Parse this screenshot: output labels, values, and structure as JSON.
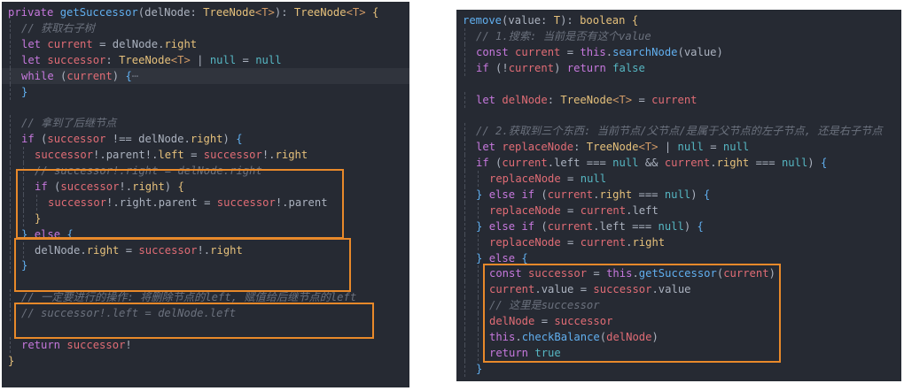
{
  "colors": {
    "background": "#262a33",
    "highlight_box": "#e8892a",
    "keyword": "#c678dd",
    "function": "#61afef",
    "type": "#e5c07b",
    "variable": "#e06c75",
    "comment": "#6b717d"
  },
  "left_code": {
    "lines": [
      {
        "indent": 0,
        "hl": false,
        "tokens": [
          [
            "kw",
            "private"
          ],
          [
            "tx",
            " "
          ],
          [
            "fn",
            "getSuccessor"
          ],
          [
            "tx",
            "(delNode: "
          ],
          [
            "ty",
            "TreeNode"
          ],
          [
            "gn",
            "<T>"
          ],
          [
            "tx",
            "): "
          ],
          [
            "ty",
            "TreeNode"
          ],
          [
            "gn",
            "<T>"
          ],
          [
            "tx",
            " "
          ],
          [
            "br",
            "{"
          ]
        ]
      },
      {
        "indent": 1,
        "hl": false,
        "tokens": [
          [
            "cm",
            "// 获取右子树"
          ]
        ]
      },
      {
        "indent": 1,
        "hl": false,
        "tokens": [
          [
            "kw",
            "let"
          ],
          [
            "tx",
            " "
          ],
          [
            "var",
            "current"
          ],
          [
            "tx",
            " = delNode."
          ],
          [
            "pr",
            "right"
          ]
        ]
      },
      {
        "indent": 1,
        "hl": false,
        "tokens": [
          [
            "kw",
            "let"
          ],
          [
            "tx",
            " "
          ],
          [
            "var",
            "successor"
          ],
          [
            "tx",
            ": "
          ],
          [
            "ty",
            "TreeNode"
          ],
          [
            "gn",
            "<T>"
          ],
          [
            "tx",
            " | "
          ],
          [
            "nl",
            "null"
          ],
          [
            "tx",
            " = "
          ],
          [
            "nl",
            "null"
          ]
        ]
      },
      {
        "indent": 1,
        "hl": true,
        "tokens": [
          [
            "kw",
            "while"
          ],
          [
            "tx",
            " ("
          ],
          [
            "var",
            "current"
          ],
          [
            "tx",
            ") "
          ],
          [
            "bl",
            "{"
          ],
          [
            "el",
            "⋯"
          ]
        ]
      },
      {
        "indent": 1,
        "hl": false,
        "tokens": [
          [
            "bl",
            "}"
          ]
        ]
      },
      {
        "indent": 0,
        "hl": false,
        "tokens": []
      },
      {
        "indent": 1,
        "hl": false,
        "tokens": [
          [
            "cm",
            "// 拿到了后继节点"
          ]
        ]
      },
      {
        "indent": 1,
        "hl": false,
        "tokens": [
          [
            "kw",
            "if"
          ],
          [
            "tx",
            " ("
          ],
          [
            "var",
            "successor"
          ],
          [
            "tx",
            " !== delNode."
          ],
          [
            "pr",
            "right"
          ],
          [
            "tx",
            ") "
          ],
          [
            "bl",
            "{"
          ]
        ]
      },
      {
        "indent": 2,
        "hl": false,
        "tokens": [
          [
            "var",
            "successor"
          ],
          [
            "tx",
            "!.parent!."
          ],
          [
            "pr",
            "left"
          ],
          [
            "tx",
            " = "
          ],
          [
            "var",
            "successor"
          ],
          [
            "tx",
            "!."
          ],
          [
            "pr",
            "right"
          ]
        ]
      },
      {
        "indent": 2,
        "hl": false,
        "tokens": [
          [
            "cm",
            "// successor!.right = delNode.right"
          ]
        ]
      },
      {
        "indent": 2,
        "hl": false,
        "tokens": [
          [
            "kw",
            "if"
          ],
          [
            "tx",
            " ("
          ],
          [
            "var",
            "successor"
          ],
          [
            "tx",
            "!."
          ],
          [
            "pr",
            "right"
          ],
          [
            "tx",
            ") "
          ],
          [
            "br",
            "{"
          ]
        ]
      },
      {
        "indent": 3,
        "hl": false,
        "tokens": [
          [
            "var",
            "successor"
          ],
          [
            "tx",
            "!.right.parent = "
          ],
          [
            "var",
            "successor"
          ],
          [
            "tx",
            "!.parent"
          ]
        ]
      },
      {
        "indent": 2,
        "hl": false,
        "tokens": [
          [
            "br",
            "}"
          ]
        ]
      },
      {
        "indent": 1,
        "hl": false,
        "tokens": [
          [
            "bl",
            "}"
          ],
          [
            "tx",
            " "
          ],
          [
            "kw",
            "else"
          ],
          [
            "tx",
            " "
          ],
          [
            "bl",
            "{"
          ]
        ]
      },
      {
        "indent": 2,
        "hl": false,
        "tokens": [
          [
            "tx",
            "delNode."
          ],
          [
            "pr",
            "right"
          ],
          [
            "tx",
            " = "
          ],
          [
            "var",
            "successor"
          ],
          [
            "tx",
            "!."
          ],
          [
            "pr",
            "right"
          ]
        ]
      },
      {
        "indent": 1,
        "hl": false,
        "tokens": [
          [
            "bl",
            "}"
          ]
        ]
      },
      {
        "indent": 0,
        "hl": false,
        "tokens": []
      },
      {
        "indent": 1,
        "hl": false,
        "tokens": [
          [
            "cm",
            "// 一定要进行的操作: 将删除节点的left, 赋值给后继节点的left"
          ]
        ]
      },
      {
        "indent": 1,
        "hl": false,
        "tokens": [
          [
            "cm",
            "// successor!.left = delNode.left"
          ]
        ]
      },
      {
        "indent": 0,
        "hl": false,
        "tokens": []
      },
      {
        "indent": 1,
        "hl": false,
        "tokens": [
          [
            "kw",
            "return"
          ],
          [
            "tx",
            " "
          ],
          [
            "var",
            "successor"
          ],
          [
            "tx",
            "!"
          ]
        ]
      },
      {
        "indent": 0,
        "hl": false,
        "tokens": [
          [
            "br",
            "}"
          ]
        ]
      }
    ]
  },
  "right_code": {
    "lines": [
      {
        "indent": 0,
        "hl": false,
        "tokens": [
          [
            "fn",
            "remove"
          ],
          [
            "tx",
            "(value: "
          ],
          [
            "ty",
            "T"
          ],
          [
            "tx",
            "): "
          ],
          [
            "ty",
            "boolean"
          ],
          [
            "tx",
            " "
          ],
          [
            "br",
            "{"
          ]
        ]
      },
      {
        "indent": 1,
        "hl": false,
        "tokens": [
          [
            "cm",
            "// 1.搜索: 当前是否有这个value"
          ]
        ]
      },
      {
        "indent": 1,
        "hl": false,
        "tokens": [
          [
            "kw",
            "const"
          ],
          [
            "tx",
            " "
          ],
          [
            "var",
            "current"
          ],
          [
            "tx",
            " = "
          ],
          [
            "kw",
            "this"
          ],
          [
            "tx",
            "."
          ],
          [
            "fn",
            "searchNode"
          ],
          [
            "tx",
            "(value)"
          ]
        ]
      },
      {
        "indent": 1,
        "hl": false,
        "tokens": [
          [
            "kw",
            "if"
          ],
          [
            "tx",
            " (!"
          ],
          [
            "var",
            "current"
          ],
          [
            "tx",
            ") "
          ],
          [
            "kw",
            "return"
          ],
          [
            "tx",
            " "
          ],
          [
            "nl",
            "false"
          ]
        ]
      },
      {
        "indent": 0,
        "hl": false,
        "tokens": []
      },
      {
        "indent": 1,
        "hl": false,
        "tokens": [
          [
            "kw",
            "let"
          ],
          [
            "tx",
            " "
          ],
          [
            "var",
            "delNode"
          ],
          [
            "tx",
            ": "
          ],
          [
            "ty",
            "TreeNode"
          ],
          [
            "gn",
            "<T>"
          ],
          [
            "tx",
            " = "
          ],
          [
            "var",
            "current"
          ]
        ]
      },
      {
        "indent": 0,
        "hl": false,
        "tokens": []
      },
      {
        "indent": 1,
        "hl": false,
        "tokens": [
          [
            "cm",
            "// 2.获取到三个东西: 当前节点/父节点/是属于父节点的左子节点, 还是右子节点"
          ]
        ]
      },
      {
        "indent": 1,
        "hl": false,
        "tokens": [
          [
            "kw",
            "let"
          ],
          [
            "tx",
            " "
          ],
          [
            "var",
            "replaceNode"
          ],
          [
            "tx",
            ": "
          ],
          [
            "ty",
            "TreeNode"
          ],
          [
            "gn",
            "<T>"
          ],
          [
            "tx",
            " | "
          ],
          [
            "nl",
            "null"
          ],
          [
            "tx",
            " = "
          ],
          [
            "nl",
            "null"
          ]
        ]
      },
      {
        "indent": 1,
        "hl": false,
        "tokens": [
          [
            "kw",
            "if"
          ],
          [
            "tx",
            " ("
          ],
          [
            "var",
            "current"
          ],
          [
            "tx",
            ".left === "
          ],
          [
            "nl",
            "null"
          ],
          [
            "tx",
            " && "
          ],
          [
            "var",
            "current"
          ],
          [
            "tx",
            "."
          ],
          [
            "pr",
            "right"
          ],
          [
            "tx",
            " === "
          ],
          [
            "nl",
            "null"
          ],
          [
            "tx",
            ") "
          ],
          [
            "bl",
            "{"
          ]
        ]
      },
      {
        "indent": 2,
        "hl": false,
        "tokens": [
          [
            "var",
            "replaceNode"
          ],
          [
            "tx",
            " = "
          ],
          [
            "nl",
            "null"
          ]
        ]
      },
      {
        "indent": 1,
        "hl": false,
        "tokens": [
          [
            "bl",
            "}"
          ],
          [
            "tx",
            " "
          ],
          [
            "kw",
            "else if"
          ],
          [
            "tx",
            " ("
          ],
          [
            "var",
            "current"
          ],
          [
            "tx",
            "."
          ],
          [
            "pr",
            "right"
          ],
          [
            "tx",
            " === "
          ],
          [
            "nl",
            "null"
          ],
          [
            "tx",
            ") "
          ],
          [
            "bl",
            "{"
          ]
        ]
      },
      {
        "indent": 2,
        "hl": false,
        "tokens": [
          [
            "var",
            "replaceNode"
          ],
          [
            "tx",
            " = "
          ],
          [
            "var",
            "current"
          ],
          [
            "tx",
            ".left"
          ]
        ]
      },
      {
        "indent": 1,
        "hl": false,
        "tokens": [
          [
            "bl",
            "}"
          ],
          [
            "tx",
            " "
          ],
          [
            "kw",
            "else if"
          ],
          [
            "tx",
            " ("
          ],
          [
            "var",
            "current"
          ],
          [
            "tx",
            ".left === "
          ],
          [
            "nl",
            "null"
          ],
          [
            "tx",
            ") "
          ],
          [
            "bl",
            "{"
          ]
        ]
      },
      {
        "indent": 2,
        "hl": false,
        "tokens": [
          [
            "var",
            "replaceNode"
          ],
          [
            "tx",
            " = "
          ],
          [
            "var",
            "current"
          ],
          [
            "tx",
            "."
          ],
          [
            "pr",
            "right"
          ]
        ]
      },
      {
        "indent": 1,
        "hl": false,
        "tokens": [
          [
            "bl",
            "}"
          ],
          [
            "tx",
            " "
          ],
          [
            "kw",
            "else"
          ],
          [
            "tx",
            " "
          ],
          [
            "bl",
            "{"
          ]
        ]
      },
      {
        "indent": 2,
        "hl": false,
        "tokens": [
          [
            "kw",
            "const"
          ],
          [
            "tx",
            " "
          ],
          [
            "var",
            "successor"
          ],
          [
            "tx",
            " = "
          ],
          [
            "kw",
            "this"
          ],
          [
            "tx",
            "."
          ],
          [
            "fn",
            "getSuccessor"
          ],
          [
            "tx",
            "("
          ],
          [
            "var",
            "current"
          ],
          [
            "tx",
            ")"
          ]
        ]
      },
      {
        "indent": 2,
        "hl": false,
        "tokens": [
          [
            "var",
            "current"
          ],
          [
            "tx",
            ".value = "
          ],
          [
            "var",
            "successor"
          ],
          [
            "tx",
            ".value"
          ]
        ]
      },
      {
        "indent": 2,
        "hl": false,
        "tokens": [
          [
            "cm",
            "// 这里是successor"
          ]
        ]
      },
      {
        "indent": 2,
        "hl": false,
        "tokens": [
          [
            "var",
            "delNode"
          ],
          [
            "tx",
            " = "
          ],
          [
            "var",
            "successor"
          ]
        ]
      },
      {
        "indent": 2,
        "hl": false,
        "tokens": [
          [
            "kw",
            "this"
          ],
          [
            "tx",
            "."
          ],
          [
            "fn",
            "checkBalance"
          ],
          [
            "tx",
            "("
          ],
          [
            "var",
            "delNode"
          ],
          [
            "tx",
            ")"
          ]
        ]
      },
      {
        "indent": 2,
        "hl": false,
        "tokens": [
          [
            "kw",
            "return"
          ],
          [
            "tx",
            " "
          ],
          [
            "nl",
            "true"
          ]
        ]
      },
      {
        "indent": 1,
        "hl": false,
        "tokens": [
          [
            "bl",
            "}"
          ]
        ]
      }
    ]
  }
}
